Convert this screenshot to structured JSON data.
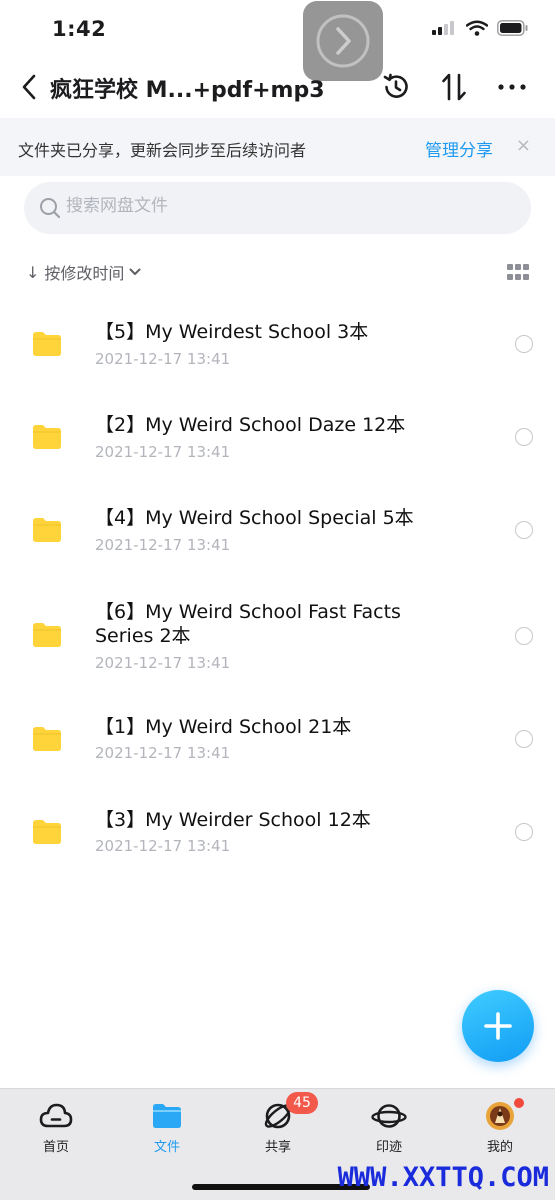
{
  "status_bar": {
    "time": "1:42"
  },
  "nav": {
    "title": "疯狂学校 M...+pdf+mp3",
    "icons": [
      "back-chevron-icon",
      "history-icon",
      "sort-arrows-icon",
      "more-icon"
    ]
  },
  "share_banner": {
    "text": "文件夹已分享，更新会同步至后续访问者",
    "manage_label": "管理分享",
    "close_label": "×"
  },
  "search": {
    "placeholder": "搜索网盘文件",
    "value": ""
  },
  "sort": {
    "arrow": "↓",
    "label": "按修改时间",
    "chevron": "⌄"
  },
  "files": [
    {
      "name": "【5】My Weirdest School 3本",
      "date": "2021-12-17 13:41"
    },
    {
      "name": "【2】My Weird School Daze 12本",
      "date": "2021-12-17 13:41"
    },
    {
      "name": "【4】My Weird School Special 5本",
      "date": "2021-12-17 13:41"
    },
    {
      "name": "【6】My Weird School Fast Facts Series 2本",
      "date": "2021-12-17 13:41"
    },
    {
      "name": "【1】My Weird School 21本",
      "date": "2021-12-17 13:41"
    },
    {
      "name": "【3】My Weirder School  12本",
      "date": "2021-12-17 13:41"
    }
  ],
  "tab_bar": {
    "tabs": [
      {
        "label": "首页",
        "icon": "cloud-icon"
      },
      {
        "label": "文件",
        "icon": "folder-icon",
        "active": true
      },
      {
        "label": "共享",
        "icon": "orbit-icon",
        "badge": "45"
      },
      {
        "label": "印迹",
        "icon": "planet-icon"
      },
      {
        "label": "我的",
        "icon": "avatar-icon"
      }
    ]
  },
  "watermark": "WWW.XXTTQ.COM",
  "colors": {
    "accent": "#1e9bf0",
    "folder": "#ffd43b",
    "badge": "#f2594b"
  }
}
